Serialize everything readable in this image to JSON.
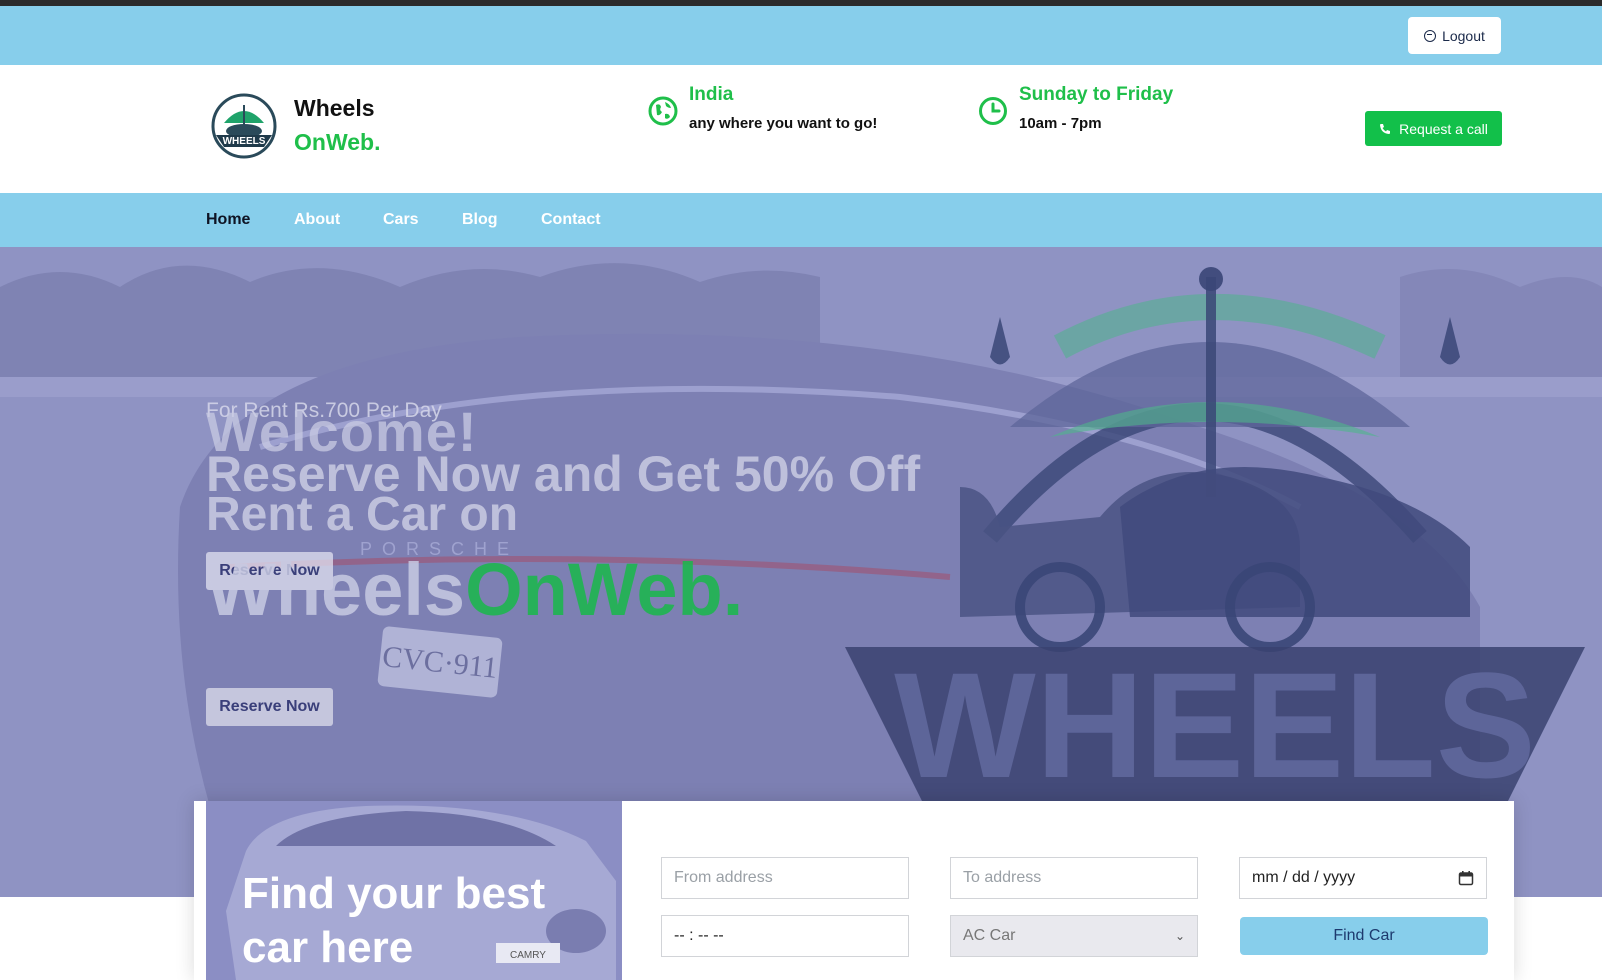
{
  "topbar": {
    "logout_label": "Logout"
  },
  "header": {
    "brand_line1": "Wheels",
    "brand_line2": "OnWeb.",
    "location": {
      "title": "India",
      "subtitle": "any where you want to go!"
    },
    "hours": {
      "title": "Sunday to Friday",
      "subtitle": "10am - 7pm"
    },
    "request_call_label": "Request a call"
  },
  "nav": {
    "items": [
      {
        "label": "Home",
        "active": true
      },
      {
        "label": "About"
      },
      {
        "label": "Cars"
      },
      {
        "label": "Blog"
      },
      {
        "label": "Contact"
      }
    ]
  },
  "hero": {
    "tagline": "For Rent Rs.700 Per Day",
    "welcome": "Welcome!",
    "offer": "Reserve Now and Get 50% Off",
    "rent_line": "Rent a Car on",
    "brand_white": "Wheels",
    "brand_green": "OnWeb.",
    "reserve_label": "Reserve Now",
    "watermark_text": "WHEELS"
  },
  "finder": {
    "title": "Find your best car here",
    "from_placeholder": "From address",
    "to_placeholder": "To address",
    "date_value": "mm / dd / yyyy",
    "time_value": "-- : --  --",
    "car_type_value": "AC Car",
    "find_label": "Find Car"
  },
  "colors": {
    "sky": "#87ceeb",
    "green": "#1fbf4a",
    "hero_overlay": "#8d90c0"
  }
}
